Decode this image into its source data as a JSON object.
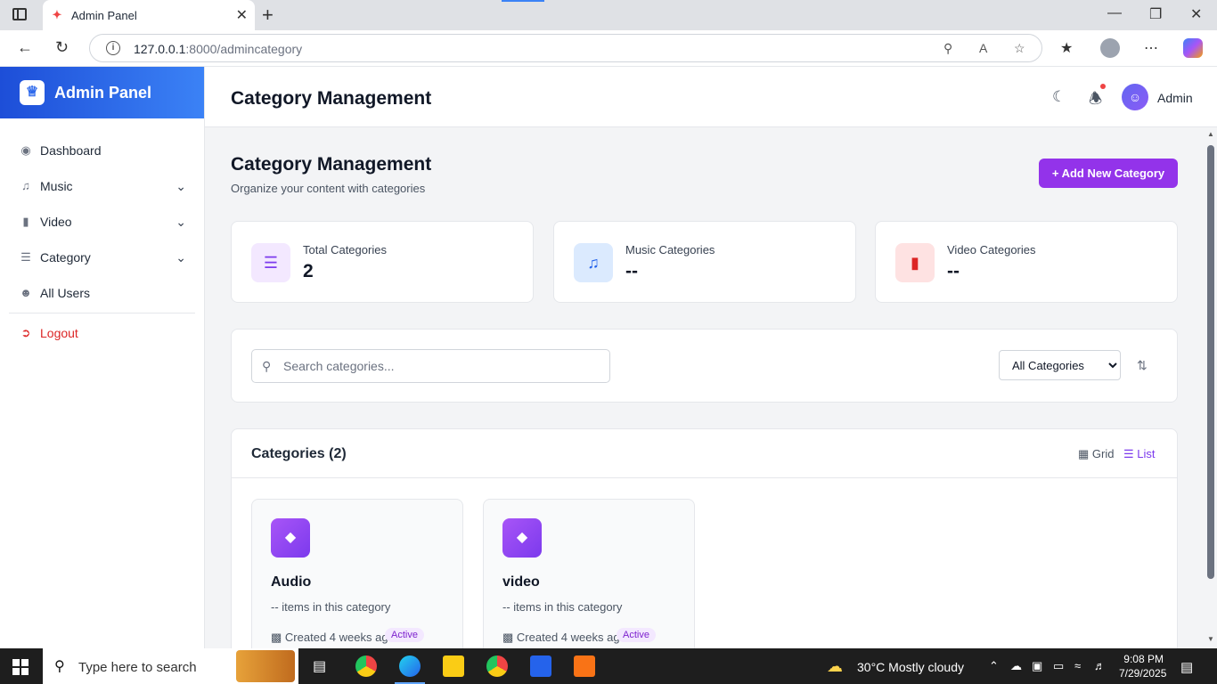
{
  "browser": {
    "tab_title": "Admin Panel",
    "url_host": "127.0.0.1",
    "url_path": ":8000/admincategory"
  },
  "sidebar": {
    "brand": "Admin Panel",
    "items": [
      {
        "label": "Dashboard",
        "icon": "dashboard-icon",
        "expandable": false
      },
      {
        "label": "Music",
        "icon": "music-icon",
        "expandable": true
      },
      {
        "label": "Video",
        "icon": "video-icon",
        "expandable": true
      },
      {
        "label": "Category",
        "icon": "layers-icon",
        "expandable": true
      },
      {
        "label": "All Users",
        "icon": "users-icon",
        "expandable": false
      }
    ],
    "logout": "Logout"
  },
  "topbar": {
    "title": "Category Management",
    "user": "Admin"
  },
  "page": {
    "title": "Category Management",
    "subtitle": "Organize your content with categories",
    "add_button": "Add New Category"
  },
  "stats": [
    {
      "label": "Total Categories",
      "value": "2",
      "color": "#7c3aed",
      "bg": "#f3e8ff"
    },
    {
      "label": "Music Categories",
      "value": "--",
      "color": "#2563eb",
      "bg": "#dbeafe"
    },
    {
      "label": "Video Categories",
      "value": "--",
      "color": "#dc2626",
      "bg": "#fee2e2"
    }
  ],
  "filters": {
    "search_placeholder": "Search categories...",
    "select_value": "All Categories"
  },
  "list": {
    "title": "Categories (2)",
    "grid_label": "Grid",
    "list_label": "List"
  },
  "categories": [
    {
      "name": "Audio",
      "items": "-- items in this category",
      "created": "Created 4 weeks ago",
      "status": "Active"
    },
    {
      "name": "video",
      "items": "-- items in this category",
      "created": "Created 4 weeks ago",
      "status": "Active"
    }
  ],
  "taskbar": {
    "search_text": "Type here to search",
    "weather": "30°C  Mostly cloudy",
    "time": "9:08 PM",
    "date": "7/29/2025"
  },
  "colors": {
    "accent": "#9333ea",
    "brand_blue": "#2563eb",
    "danger": "#dc2626"
  }
}
